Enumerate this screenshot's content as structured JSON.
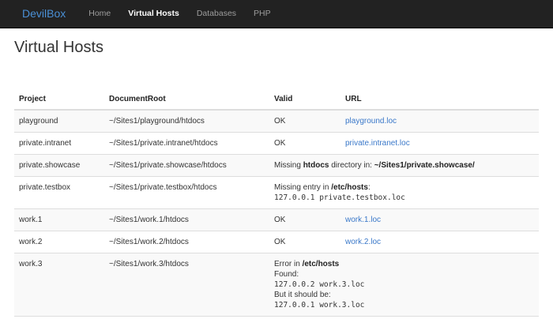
{
  "nav": {
    "brand_prefix": "Devil",
    "brand_accent": "Box",
    "items": [
      {
        "label": "Home"
      },
      {
        "label": "Virtual Hosts"
      },
      {
        "label": "Databases"
      },
      {
        "label": "PHP"
      }
    ]
  },
  "page": {
    "title": "Virtual Hosts"
  },
  "table": {
    "headers": [
      "Project",
      "DocumentRoot",
      "Valid",
      "URL"
    ],
    "rows": [
      {
        "project": "playground",
        "docroot": "~/Sites1/playground/htdocs",
        "valid": "OK",
        "url": "playground.loc"
      },
      {
        "project": "private.intranet",
        "docroot": "~/Sites1/private.intranet/htdocs",
        "valid": "OK",
        "url": "private.intranet.loc"
      },
      {
        "project": "private.showcase",
        "docroot": "~/Sites1/private.showcase/htdocs",
        "msg_pre": "Missing ",
        "msg_b1": "htdocs",
        "msg_mid": " directory in: ",
        "msg_b2": "~/Sites1/private.showcase/"
      },
      {
        "project": "private.testbox",
        "docroot": "~/Sites1/private.testbox/htdocs",
        "msg_pre": "Missing entry in ",
        "msg_b1": "/etc/hosts",
        "msg_post": ":",
        "code": "127.0.0.1 private.testbox.loc"
      },
      {
        "project": "work.1",
        "docroot": "~/Sites1/work.1/htdocs",
        "valid": "OK",
        "url": "work.1.loc"
      },
      {
        "project": "work.2",
        "docroot": "~/Sites1/work.2/htdocs",
        "valid": "OK",
        "url": "work.2.loc"
      },
      {
        "project": "work.3",
        "docroot": "~/Sites1/work.3/htdocs",
        "msg_pre": "Error in ",
        "msg_b1": "/etc/hosts",
        "found_label": "Found:",
        "found_code": "127.0.0.2 work.3.loc",
        "should_label": "But it should be:",
        "should_code": "127.0.0.1 work.3.loc"
      }
    ]
  },
  "colors": {
    "navbar": "#222222",
    "brand_accent": "#4a90d6",
    "link": "#3a78c9"
  }
}
